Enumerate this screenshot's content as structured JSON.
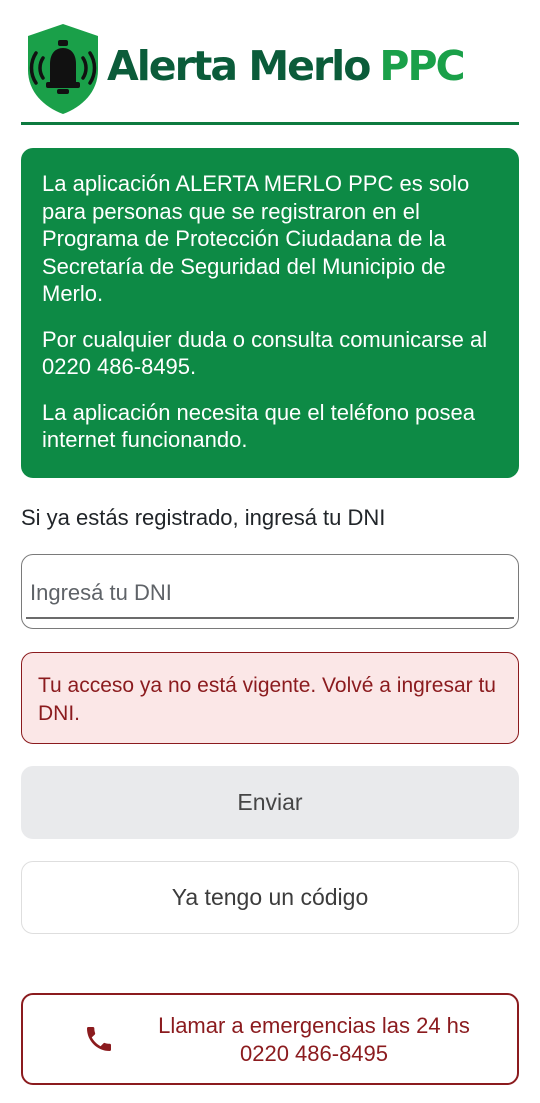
{
  "header": {
    "brand_main": "Alerta Merlo",
    "brand_suffix": "PPC",
    "colors": {
      "dark_green": "#0b5c3a",
      "light_green": "#1aa049"
    }
  },
  "info_box": {
    "paragraphs": [
      "La aplicación ALERTA MERLO PPC es solo para personas que se registraron en el Programa de Protección Ciudadana de la Secretaría de Seguridad del Municipio de Merlo.",
      "Por cualquier duda o consulta comunicarse al 0220 486-8495.",
      "La aplicación necesita que el teléfono posea internet funcionando."
    ],
    "background": "#0d8a45"
  },
  "form": {
    "prompt": "Si ya estás registrado, ingresá tu DNI",
    "dni_placeholder": "Ingresá tu DNI",
    "dni_value": ""
  },
  "alert": {
    "message": "Tu acceso ya no está vigente. Volvé a ingresar tu DNI.",
    "color": "#8b1b1e"
  },
  "buttons": {
    "send_label": "Enviar",
    "code_label": "Ya tengo un código"
  },
  "emergency": {
    "line1": "Llamar a emergencias las 24 hs",
    "line2": "0220 486-8495",
    "icon": "phone-icon"
  }
}
